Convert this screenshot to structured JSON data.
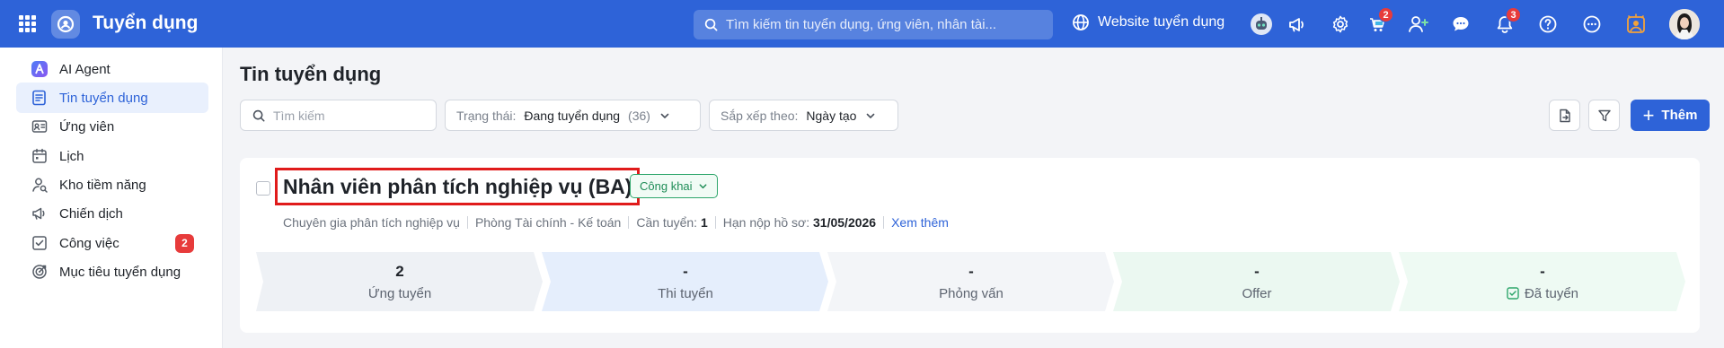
{
  "header": {
    "app_title": "Tuyển dụng",
    "search_placeholder": "Tìm kiếm tin tuyển dụng, ứng viên, nhân tài...",
    "website_label": "Website tuyển dụng",
    "cart_badge": "2",
    "notification_badge": "3",
    "icons": [
      "apps-grid-icon",
      "app-logo-icon",
      "search-icon",
      "globe-icon",
      "ai-bot-icon",
      "megaphone-icon",
      "gear-icon",
      "cart-icon",
      "add-user-icon",
      "chat-icon",
      "bell-icon",
      "help-icon",
      "more-icon",
      "sun-badge-icon",
      "avatar"
    ]
  },
  "sidebar": {
    "items": [
      {
        "label": "AI Agent",
        "icon": "ai-agent-icon"
      },
      {
        "label": "Tin tuyển dụng",
        "icon": "document-icon",
        "active": true
      },
      {
        "label": "Ứng viên",
        "icon": "id-card-icon"
      },
      {
        "label": "Lịch",
        "icon": "calendar-icon"
      },
      {
        "label": "Kho tiềm năng",
        "icon": "talent-pool-icon"
      },
      {
        "label": "Chiến dịch",
        "icon": "campaign-icon"
      },
      {
        "label": "Công việc",
        "icon": "task-icon",
        "badge": "2"
      },
      {
        "label": "Mục tiêu tuyển dụng",
        "icon": "target-icon"
      }
    ]
  },
  "main": {
    "title": "Tin tuyển dụng",
    "search_placeholder": "Tìm kiếm",
    "status_filter": {
      "label": "Trạng thái:",
      "value": "Đang tuyển dụng",
      "count": "(36)"
    },
    "sort_filter": {
      "label": "Sắp xếp theo:",
      "value": "Ngày tạo"
    },
    "add_button": "Thêm"
  },
  "job": {
    "title": "Nhân viên phân tích nghiệp vụ (BA)",
    "visibility": "Công khai",
    "position": "Chuyên gia phân tích nghiệp vụ",
    "department": "Phòng Tài chính - Kế toán",
    "need_label": "Cần tuyển:",
    "need_value": "1",
    "deadline_label": "Hạn nộp hồ sơ:",
    "deadline_value": "31/05/2026",
    "more_link": "Xem thêm",
    "stages": [
      {
        "count": "2",
        "label": "Ứng tuyển",
        "color": "#eef1f5"
      },
      {
        "count": "-",
        "label": "Thi tuyển",
        "color": "#e5eefc"
      },
      {
        "count": "-",
        "label": "Phỏng vấn",
        "color": "#f3f5f8"
      },
      {
        "count": "-",
        "label": "Offer",
        "color": "#ebf8f1"
      },
      {
        "count": "-",
        "label": "Đã tuyển",
        "color": "#eefaf3"
      }
    ]
  }
}
